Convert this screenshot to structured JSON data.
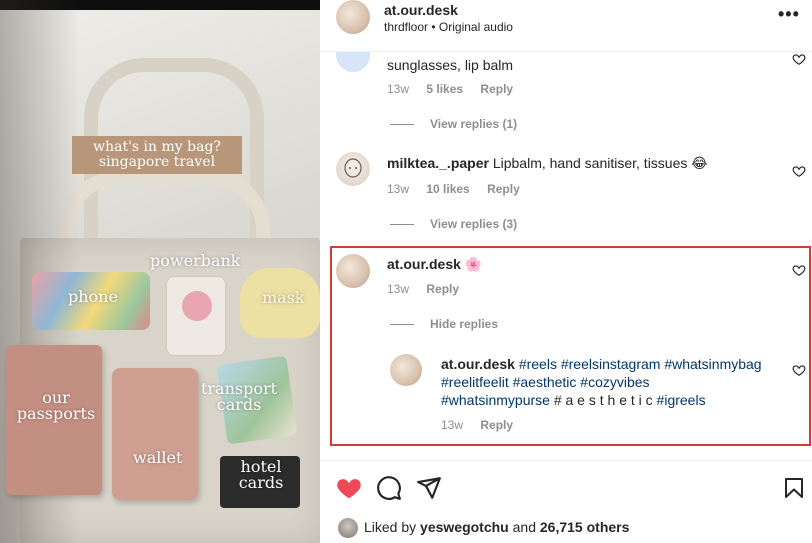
{
  "media": {
    "overlay_title_line1": "what's in my bag?",
    "overlay_title_line2": "singapore travel",
    "labels": {
      "powerbank": "powerbank",
      "phone": "phone",
      "mask": "mask",
      "passports_line1": "our",
      "passports_line2": "passports",
      "transport_line1": "transport",
      "transport_line2": "cards",
      "wallet": "wallet",
      "hotel_line1": "hotel",
      "hotel_line2": "cards"
    }
  },
  "header": {
    "username": "at.our.desk",
    "audio_artist": "thrdfloor",
    "separator": "•",
    "audio_label": "Original audio",
    "more_icon": "more-horizontal-icon"
  },
  "comments": {
    "first": {
      "text": "sunglasses, lip balm",
      "time": "13w",
      "likes": "5 likes",
      "reply": "Reply",
      "view_replies": "View replies (1)"
    },
    "second": {
      "username": "milktea._.paper",
      "text": "Lipbalm, hand sanitiser, tissues 😂",
      "time": "13w",
      "likes": "10 likes",
      "reply": "Reply",
      "view_replies": "View replies (3)"
    },
    "third": {
      "username": "at.our.desk",
      "text": "🌸",
      "time": "13w",
      "reply": "Reply",
      "hide_replies": "Hide replies",
      "reply_item": {
        "username": "at.our.desk",
        "line1": "#reels #reelsinstagram #whatsinmybag",
        "line2": "#reelitfeelit #aesthetic #cozyvibes",
        "line3_tag": "#whatsinmypurse",
        "line3_plain": "# a e s t h e t i c",
        "line3_tag2": "#igreels",
        "time": "13w",
        "reply": "Reply"
      }
    }
  },
  "actions": {
    "like_icon": "heart-filled-icon",
    "comment_icon": "comment-icon",
    "share_icon": "send-icon",
    "save_icon": "bookmark-icon",
    "liked_prefix": "Liked by",
    "liked_user": "yeswegotchu",
    "liked_and": "and",
    "liked_count": "26,715 others"
  },
  "colors": {
    "heart": "#ed4956",
    "hashtag": "#00376b",
    "highlight_border": "#d83a35",
    "muted_text": "#8e8e8e"
  }
}
